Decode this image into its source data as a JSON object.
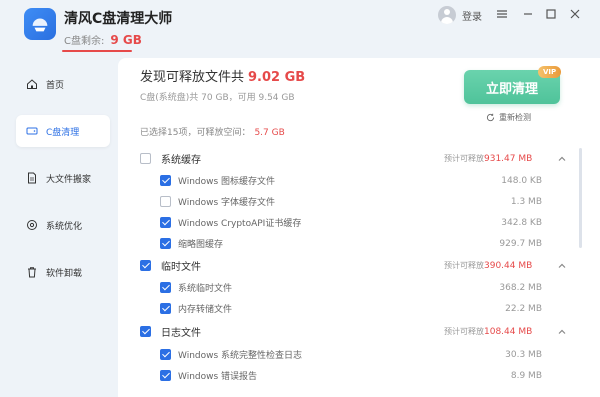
{
  "app": {
    "title": "清风C盘清理大师",
    "remain_label": "C盘剩余:",
    "remain_value": "9 GB",
    "login": "登录"
  },
  "sidebar": {
    "items": [
      {
        "label": "首页",
        "icon": "home-icon"
      },
      {
        "label": "C盘清理",
        "icon": "disk-icon"
      },
      {
        "label": "大文件搬家",
        "icon": "file-icon"
      },
      {
        "label": "系统优化",
        "icon": "optimize-icon"
      },
      {
        "label": "软件卸载",
        "icon": "trash-icon"
      }
    ]
  },
  "summary": {
    "found_prefix": "发现可释放文件共",
    "found_value": "9.02 GB",
    "disk_info": "C盘(系统盘)共 70 GB，可用 9.54 GB",
    "selected_prefix": "已选择15项，可释放空间：",
    "selected_value": "5.7 GB"
  },
  "actions": {
    "clean_label": "立即清理",
    "vip_badge": "VIP",
    "redetect_label": "重新检测"
  },
  "categories": [
    {
      "name": "系统缓存",
      "checked": false,
      "est_prefix": "预计可释放",
      "est_value": "931.47 MB",
      "items": [
        {
          "name": "Windows 图标缓存文件",
          "size": "148.0 KB",
          "checked": true
        },
        {
          "name": "Windows 字体缓存文件",
          "size": "1.3 MB",
          "checked": false
        },
        {
          "name": "Windows CryptoAPI证书缓存",
          "size": "342.8 KB",
          "checked": true
        },
        {
          "name": "缩略图缓存",
          "size": "929.7 MB",
          "checked": true
        }
      ]
    },
    {
      "name": "临时文件",
      "checked": true,
      "est_prefix": "预计可释放",
      "est_value": "390.44 MB",
      "items": [
        {
          "name": "系统临时文件",
          "size": "368.2 MB",
          "checked": true
        },
        {
          "name": "内存转储文件",
          "size": "22.2 MB",
          "checked": true
        }
      ]
    },
    {
      "name": "日志文件",
      "checked": true,
      "est_prefix": "预计可释放",
      "est_value": "108.44 MB",
      "items": [
        {
          "name": "Windows 系统完整性检查日志",
          "size": "30.3 MB",
          "checked": true
        },
        {
          "name": "Windows 错误报告",
          "size": "8.9 MB",
          "checked": true
        }
      ]
    }
  ],
  "colors": {
    "accent": "#2b6fe4",
    "danger": "#e64a4a",
    "clean_button": "#4fc39a"
  }
}
